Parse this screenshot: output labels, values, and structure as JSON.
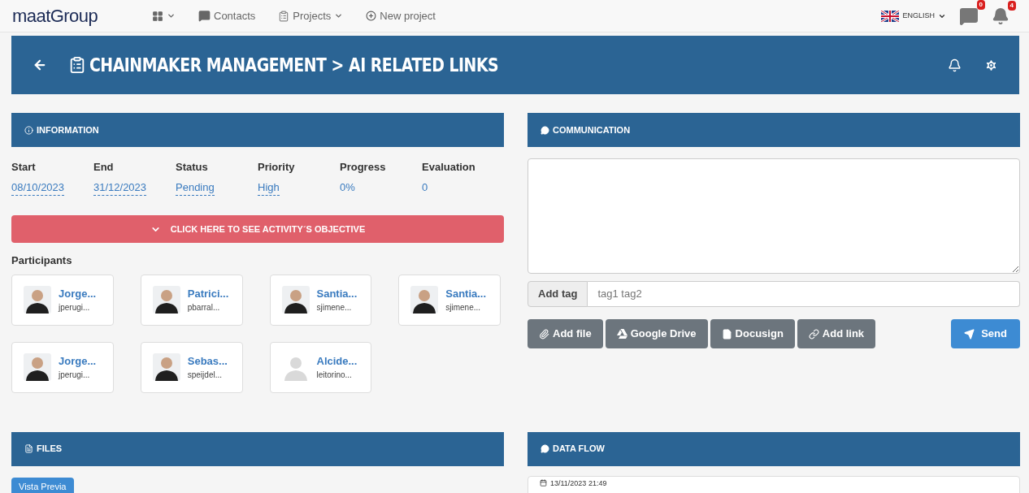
{
  "navbar": {
    "logo": "maatGroup",
    "menu": [
      {
        "kind": "apps"
      },
      {
        "kind": "contacts",
        "label": "Contacts"
      },
      {
        "kind": "projects",
        "label": "Projects"
      },
      {
        "kind": "new",
        "label": "New project"
      }
    ],
    "language": "ENGLISH",
    "messages_badge": "0",
    "notifications_badge": "4"
  },
  "header": {
    "title": "CHAINMAKER MANAGEMENT > AI RELATED LINKS"
  },
  "information": {
    "title": "INFORMATION",
    "fields": [
      {
        "label": "Start",
        "value": "08/10/2023",
        "editable": true
      },
      {
        "label": "End",
        "value": "31/12/2023",
        "editable": true
      },
      {
        "label": "Status",
        "value": "Pending",
        "editable": true
      },
      {
        "label": "Priority",
        "value": "High",
        "editable": true
      },
      {
        "label": "Progress",
        "value": "0%",
        "editable": false
      },
      {
        "label": "Evaluation",
        "value": "0",
        "editable": false
      }
    ],
    "objective_button": "CLICK HERE TO SEE ACTIVITY´S OBJECTIVE",
    "participants_label": "Participants",
    "participants": [
      {
        "name": "Jorge...",
        "user": "jperugi...",
        "kind": "photo"
      },
      {
        "name": "Patrici...",
        "user": "pbarral...",
        "kind": "photo"
      },
      {
        "name": "Santia...",
        "user": "sjimene...",
        "kind": "photo"
      },
      {
        "name": "Santia...",
        "user": "sjimene...",
        "kind": "photo"
      },
      {
        "name": "Jorge...",
        "user": "jperugi...",
        "kind": "photo"
      },
      {
        "name": "Sebas...",
        "user": "speijdel...",
        "kind": "photo"
      },
      {
        "name": "Alcide...",
        "user": "leitorino...",
        "kind": "placeholder"
      }
    ]
  },
  "communication": {
    "title": "COMMUNICATION",
    "tag_label": "Add tag",
    "tag_placeholder": "tag1 tag2",
    "buttons": [
      {
        "kind": "file",
        "label": "Add file"
      },
      {
        "kind": "drive",
        "label": "Google Drive"
      },
      {
        "kind": "doc",
        "label": "Docusign"
      },
      {
        "kind": "link",
        "label": "Add link"
      }
    ],
    "send": "Send"
  },
  "files": {
    "title": "FILES",
    "preview_button": "Vista Previa"
  },
  "data_flow": {
    "title": "DATA FLOW",
    "entries": [
      {
        "date": "13/11/2023 21:49"
      }
    ]
  }
}
